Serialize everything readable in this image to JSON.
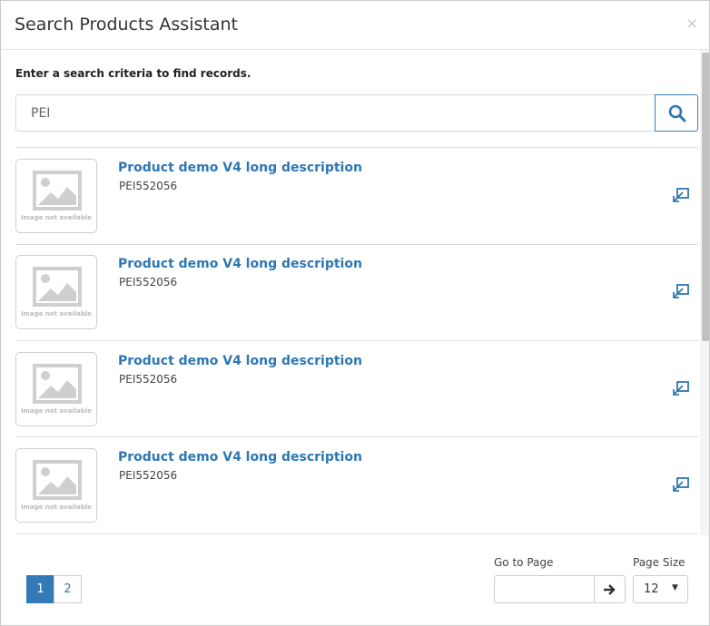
{
  "modal": {
    "title": "Search Products Assistant",
    "close_glyph": "×"
  },
  "search": {
    "instruction": "Enter a search criteria to find records.",
    "value": "PEI",
    "button_icon": "search-icon"
  },
  "results": [
    {
      "title": "Product demo V4 long description",
      "code": "PEI552056",
      "image_text": "Image not available",
      "action_icon": "open-link-icon"
    },
    {
      "title": "Product demo V4 long description",
      "code": "PEI552056",
      "image_text": "Image not available",
      "action_icon": "open-link-icon"
    },
    {
      "title": "Product demo V4 long description",
      "code": "PEI552056",
      "image_text": "Image not available",
      "action_icon": "open-link-icon"
    },
    {
      "title": "Product demo V4 long description",
      "code": "PEI552056",
      "image_text": "Image not available",
      "action_icon": "open-link-icon"
    }
  ],
  "pagination": {
    "pages": [
      "1",
      "2"
    ],
    "current": "1",
    "goto_label": "Go to Page",
    "goto_value": "",
    "page_size_label": "Page Size",
    "page_size": "12",
    "page_size_caret": "▼"
  },
  "colors": {
    "accent": "#337ab7",
    "link": "#2d77b3",
    "border": "#cccccc"
  }
}
